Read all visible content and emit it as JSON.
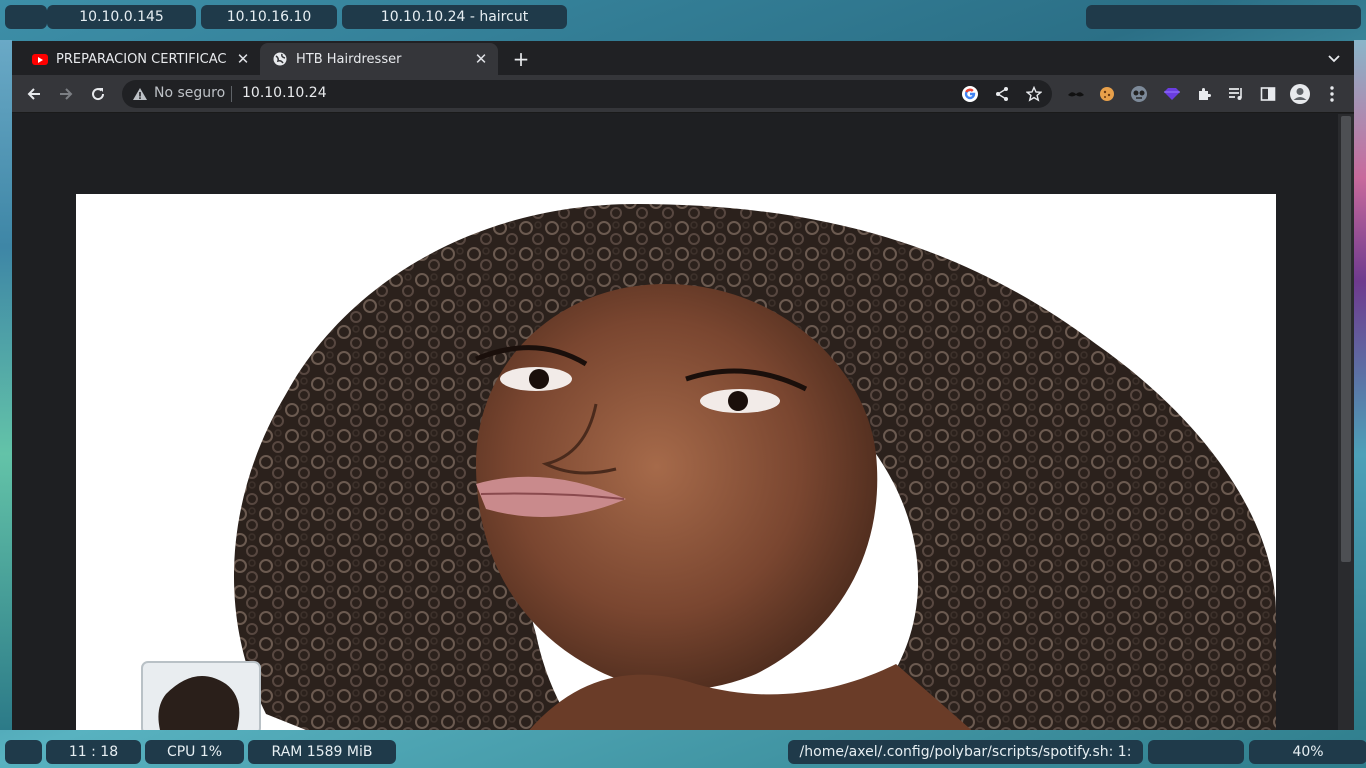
{
  "topbar": {
    "workspaces": [
      "",
      "10.10.0.145",
      "10.10.16.10",
      "10.10.10.24 - haircut"
    ]
  },
  "browser": {
    "tabs": [
      {
        "title": "PREPARACIÓN CERTIFICACI",
        "favicon": "youtube-icon",
        "active": false
      },
      {
        "title": "HTB Hairdresser",
        "favicon": "globe-icon",
        "active": true
      }
    ],
    "toolbar": {
      "security_label": "No seguro",
      "url": "10.10.10.24"
    },
    "page": {
      "image": "curly-hair-woman-photo"
    }
  },
  "bottombar": {
    "time": "11 : 18",
    "cpu": "CPU 1%",
    "ram": "RAM 1589 MiB",
    "spotify": "/home/axel/.config/polybar/scripts/spotify.sh: 1:",
    "volume": "40%"
  },
  "colors": {
    "bar_bg": "#1f3a4a",
    "tab_active": "#35363a",
    "tabstrip": "#202124",
    "page_bg": "#1e1f22"
  }
}
